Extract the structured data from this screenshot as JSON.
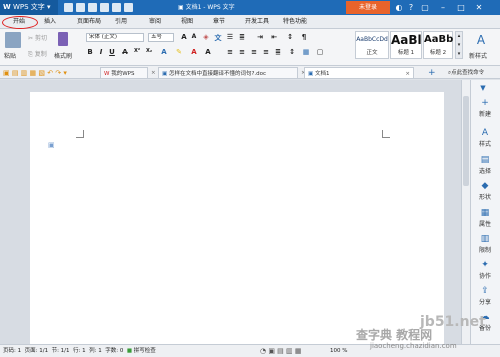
{
  "app": {
    "name": "WPS 文字",
    "doc_title": "文档1 - WPS 文字",
    "login_label": "未登录"
  },
  "menu": [
    "开始",
    "插入",
    "页面布局",
    "引用",
    "审阅",
    "视图",
    "章节",
    "开发工具",
    "特色功能"
  ],
  "ribbon": {
    "paste_label": "粘贴",
    "cut_label": "剪切",
    "copy_label": "复制",
    "format_painter_label": "格式刷",
    "font_name": "宋体 (正文)",
    "font_size": "五号",
    "styles": [
      {
        "preview": "AaBbCcDd",
        "name": "正文"
      },
      {
        "preview": "AaBl",
        "name": "标题 1"
      },
      {
        "preview": "AaBb",
        "name": "标题 2"
      }
    ],
    "new_style_label": "新样式"
  },
  "tabs": [
    {
      "label": "我的WPS"
    },
    {
      "label": "怎样在文档中直接翻译不懂的词句?.doc"
    },
    {
      "label": "文档1"
    }
  ],
  "tab_right_label": "点此查找命令",
  "right_panel": [
    {
      "label": "新建",
      "icon": "+"
    },
    {
      "label": "样式",
      "icon": "A"
    },
    {
      "label": "选择",
      "icon": "▤"
    },
    {
      "label": "形状",
      "icon": "◆"
    },
    {
      "label": "属性",
      "icon": "▦"
    },
    {
      "label": "限制",
      "icon": "▥"
    },
    {
      "label": "协作",
      "icon": "✦"
    },
    {
      "label": "分享",
      "icon": "⇪"
    },
    {
      "label": "备份",
      "icon": "☁"
    }
  ],
  "status": {
    "page_label": "页码: 1",
    "pages": "页面: 1/1",
    "section": "节: 1/1",
    "row": "行: 1",
    "col": "列: 1",
    "words": "字数: 0",
    "spell": "拼写检查",
    "zoom": "100 %"
  },
  "watermark": {
    "line1": "jb51.net",
    "line2": "查字典 教程网",
    "line3": "jiaocheng.chazidian.com"
  },
  "colors": {
    "title_blue": "#1f6bb7",
    "login_orange": "#e8632b",
    "highlight_ring": "#e02020"
  }
}
